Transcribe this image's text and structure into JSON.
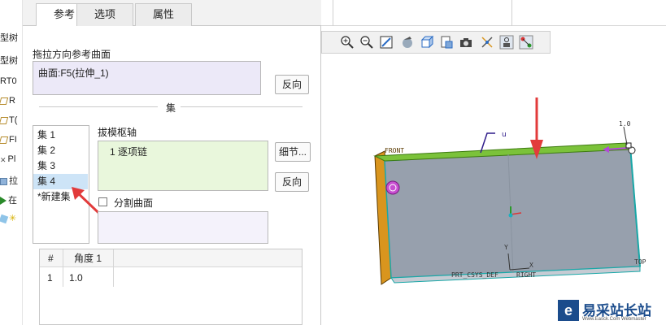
{
  "tabs": [
    {
      "label": "参考"
    },
    {
      "label": "选项"
    },
    {
      "label": "属性"
    }
  ],
  "tree": {
    "items": [
      "型树",
      "型树",
      "RT0",
      "R",
      "T(",
      "FI",
      "Pl",
      "拉",
      "在",
      ""
    ]
  },
  "panel": {
    "ref_surface_label": "拖拉方向参考曲面",
    "ref_surface_value": "曲面:F5(拉伸_1)",
    "flip_button_1": "反向",
    "sets_section": "集",
    "sets": [
      "集 1",
      "集 2",
      "集 3",
      "集 4",
      "*新建集"
    ],
    "selected_set_index": 3,
    "hinge_label": "拔模枢轴",
    "hinge_value": "1 逐项链",
    "details_button": "细节...",
    "flip_button_2": "反向",
    "split_label": "分割曲面",
    "split_checked": false,
    "table": {
      "headers": [
        "#",
        "角度 1"
      ],
      "rows": [
        [
          "1",
          "1.0"
        ]
      ]
    }
  },
  "viewport": {
    "labels": {
      "front": "FRONT",
      "top": "TOP",
      "csys": "PRT_CSYS_DEF",
      "right": "RIGHT",
      "dim": "1.0",
      "y": "Y",
      "x": "X"
    },
    "colors": {
      "face": "#97a0ad",
      "edge_green": "#7bc23a",
      "side_orange": "#d9951e",
      "arrow_red": "#e23b3b"
    }
  },
  "icons": [
    "zoom-in-icon",
    "zoom-out-icon",
    "refit-icon",
    "shading-icon",
    "view-box-icon",
    "saved-views-icon",
    "camera-icon",
    "datum-display-icon",
    "spin-center-icon",
    "annotation-icon"
  ],
  "watermark": {
    "name": "易采站长站",
    "sub": "Www.Easck.Com Webmaster"
  }
}
